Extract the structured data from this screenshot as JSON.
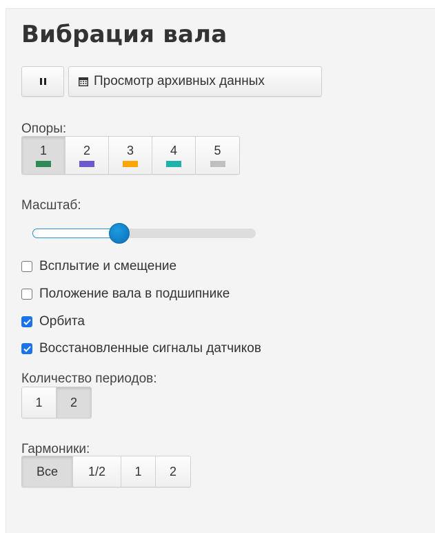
{
  "panel": {
    "title": "Вибрация вала"
  },
  "toolbar": {
    "pause_icon": "pause-icon",
    "archive_icon": "calendar-icon",
    "archive_label": "Просмотр архивных данных"
  },
  "supports": {
    "label": "Опоры:",
    "items": [
      {
        "label": "1",
        "color": "#2e8b57",
        "active": true
      },
      {
        "label": "2",
        "color": "#6a5acd",
        "active": false
      },
      {
        "label": "3",
        "color": "#ffa500",
        "active": false
      },
      {
        "label": "4",
        "color": "#20b2aa",
        "active": false
      },
      {
        "label": "5",
        "color": "#c0c0c0",
        "active": false
      }
    ]
  },
  "scale": {
    "label": "Масштаб:",
    "value_fraction": 0.39,
    "accent": "#0a7cc4"
  },
  "options": [
    {
      "label": "Всплытие и смещение",
      "checked": false
    },
    {
      "label": "Положение вала в подшипнике",
      "checked": false
    },
    {
      "label": "Орбита",
      "checked": true
    },
    {
      "label": "Восстановленные сигналы датчиков",
      "checked": true
    }
  ],
  "periods": {
    "label": "Количество периодов:",
    "items": [
      {
        "label": "1",
        "active": false
      },
      {
        "label": "2",
        "active": true
      }
    ]
  },
  "harmonics": {
    "label": "Гармоники:",
    "items": [
      {
        "label": "Все",
        "active": true
      },
      {
        "label": "1/2",
        "active": false
      },
      {
        "label": "1",
        "active": false
      },
      {
        "label": "2",
        "active": false
      }
    ]
  }
}
